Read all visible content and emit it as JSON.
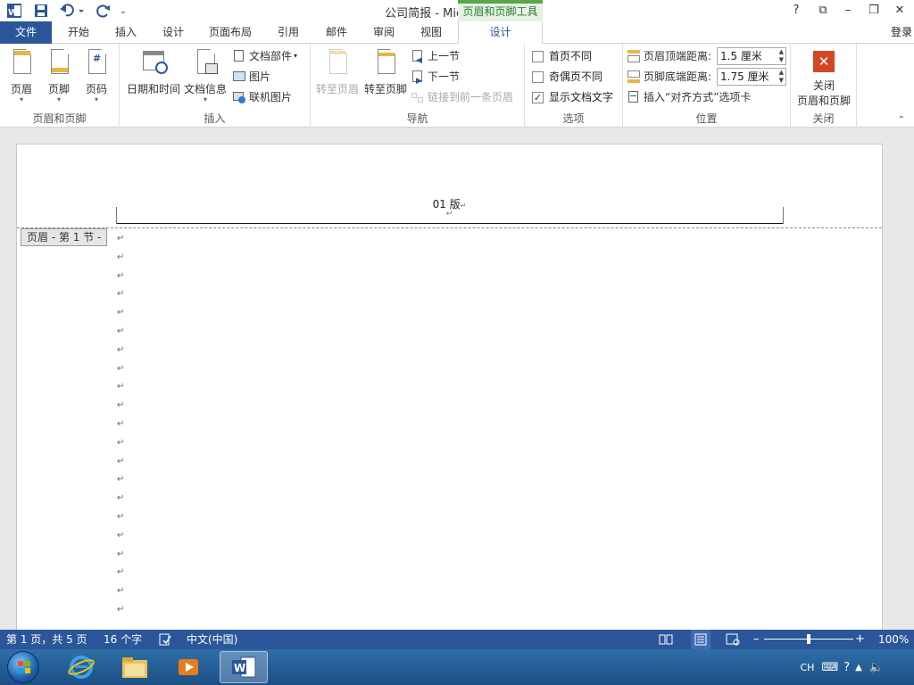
{
  "window": {
    "title": "公司简报 - Microsoft Word",
    "context_tab_header": "页眉和页脚工具",
    "help": "?",
    "restore_ribbon": "⧉",
    "minimize": "–",
    "maximize": "❐",
    "close": "✕"
  },
  "tabs": {
    "file": "文件",
    "items": [
      "开始",
      "插入",
      "设计",
      "页面布局",
      "引用",
      "邮件",
      "审阅",
      "视图"
    ],
    "active": "设计",
    "login": "登录"
  },
  "ribbon": {
    "groups": {
      "header_footer": "页眉和页脚",
      "insert": "插入",
      "navigation": "导航",
      "options": "选项",
      "position": "位置",
      "close": "关闭"
    },
    "header_btn": "页眉",
    "footer_btn": "页脚",
    "page_number_btn": "页码",
    "date_time_btn": "日期和时间",
    "doc_info_btn": "文档信息",
    "quick_parts_btn": "文档部件",
    "picture_btn": "图片",
    "online_picture_btn": "联机图片",
    "goto_header_btn": "转至页眉",
    "goto_footer_btn": "转至页脚",
    "prev_section_btn": "上一节",
    "next_section_btn": "下一节",
    "link_prev_btn": "链接到前一条页眉",
    "diff_first_page": "首页不同",
    "diff_odd_even": "奇偶页不同",
    "show_doc_text": "显示文档文字",
    "show_doc_text_checked": true,
    "header_top_label": "页眉顶端距离:",
    "header_top_value": "1.5 厘米",
    "footer_bottom_label": "页脚底端距离:",
    "footer_bottom_value": "1.75 厘米",
    "insert_align_tab": "插入“对齐方式”选项卡",
    "close_hf_line1": "关闭",
    "close_hf_line2": "页眉和页脚"
  },
  "document": {
    "header_text": "01 版",
    "para_mark": "↵",
    "header_marker": "↵",
    "section_tag": "页眉 - 第 1 节 -"
  },
  "status": {
    "page": "第 1 页，共 5 页",
    "words": "16 个字",
    "language": "中文(中国)",
    "zoom": "100%",
    "zoom_level": 1.0
  },
  "taskbar": {
    "tray_lang": "CH"
  },
  "colors": {
    "word_blue": "#2b579a",
    "context_green": "#5aa549",
    "close_red": "#d24726"
  }
}
